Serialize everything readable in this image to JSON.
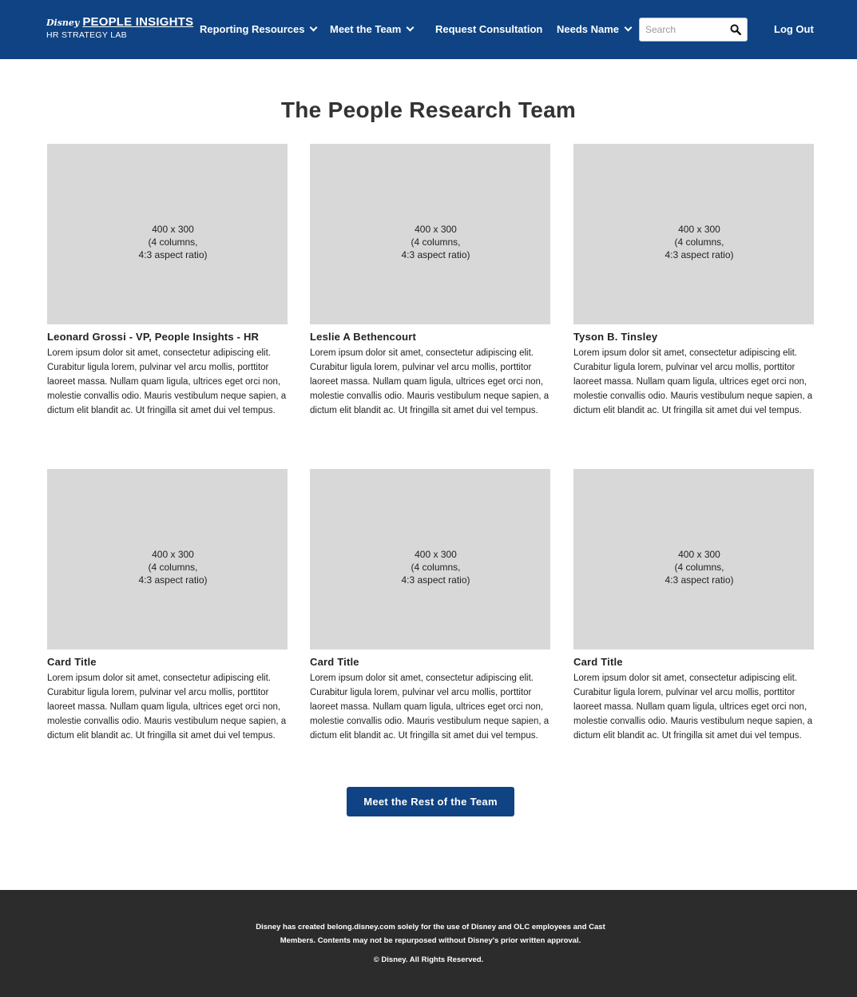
{
  "header": {
    "brand": "Disney",
    "title": "PEOPLE INSIGHTS",
    "subtitle": "HR STRATEGY LAB",
    "nav": [
      {
        "label": "Reporting Resources"
      },
      {
        "label": "Meet the Team"
      },
      {
        "label": "Request Consultation"
      },
      {
        "label": "Needs Name"
      }
    ],
    "search_placeholder": "Search",
    "logout_label": "Log Out"
  },
  "main": {
    "title": "The People Research Team",
    "image_placeholder": {
      "line1": "400 x 300",
      "line2": "(4 columns,",
      "line3": "4:3 aspect ratio)"
    },
    "cards": [
      {
        "title": "Leonard Grossi - VP, People Insights - HR",
        "body": "Lorem ipsum dolor sit amet, consectetur adipiscing elit. Curabitur ligula lorem, pulvinar vel arcu mollis, porttitor laoreet massa. Nullam quam ligula, ultrices eget orci non, molestie convallis odio. Mauris vestibulum neque sapien, a dictum elit blandit ac. Ut fringilla sit amet dui vel tempus."
      },
      {
        "title": "Leslie A Bethencourt",
        "body": "Lorem ipsum dolor sit amet, consectetur adipiscing elit. Curabitur ligula lorem, pulvinar vel arcu mollis, porttitor laoreet massa. Nullam quam ligula, ultrices eget orci non, molestie convallis odio. Mauris vestibulum neque sapien, a dictum elit blandit ac. Ut fringilla sit amet dui vel tempus."
      },
      {
        "title": "Tyson B. Tinsley",
        "body": "Lorem ipsum dolor sit amet, consectetur adipiscing elit. Curabitur ligula lorem, pulvinar vel arcu mollis, porttitor laoreet massa. Nullam quam ligula, ultrices eget orci non, molestie convallis odio. Mauris vestibulum neque sapien, a dictum elit blandit ac. Ut fringilla sit amet dui vel tempus."
      },
      {
        "title": "Card Title",
        "body": "Lorem ipsum dolor sit amet, consectetur adipiscing elit. Curabitur ligula lorem, pulvinar vel arcu mollis, porttitor laoreet massa. Nullam quam ligula, ultrices eget orci non, molestie convallis odio. Mauris vestibulum neque sapien, a dictum elit blandit ac. Ut fringilla sit amet dui vel tempus."
      },
      {
        "title": "Card Title",
        "body": "Lorem ipsum dolor sit amet, consectetur adipiscing elit. Curabitur ligula lorem, pulvinar vel arcu mollis, porttitor laoreet massa. Nullam quam ligula, ultrices eget orci non, molestie convallis odio. Mauris vestibulum neque sapien, a dictum elit blandit ac. Ut fringilla sit amet dui vel tempus."
      },
      {
        "title": "Card Title",
        "body": "Lorem ipsum dolor sit amet, consectetur adipiscing elit. Curabitur ligula lorem, pulvinar vel arcu mollis, porttitor laoreet massa. Nullam quam ligula, ultrices eget orci non, molestie convallis odio. Mauris vestibulum neque sapien, a dictum elit blandit ac. Ut fringilla sit amet dui vel tempus."
      }
    ],
    "cta_label": "Meet the Rest of the Team"
  },
  "footer": {
    "notice": "Disney has created belong.disney.com solely for the use of Disney and OLC employees and Cast Members. Contents may not be repurposed without Disney's prior written approval.",
    "copyright": "© Disney. All Rights Reserved."
  },
  "colors": {
    "header_bg": "#0f4383",
    "button_bg": "#0f4383",
    "image_placeholder_bg": "#d8d8d8",
    "footer_bg": "#2c2c2c"
  },
  "icons": {
    "search": "search-icon",
    "dropdown": "chevron-down-icon"
  }
}
